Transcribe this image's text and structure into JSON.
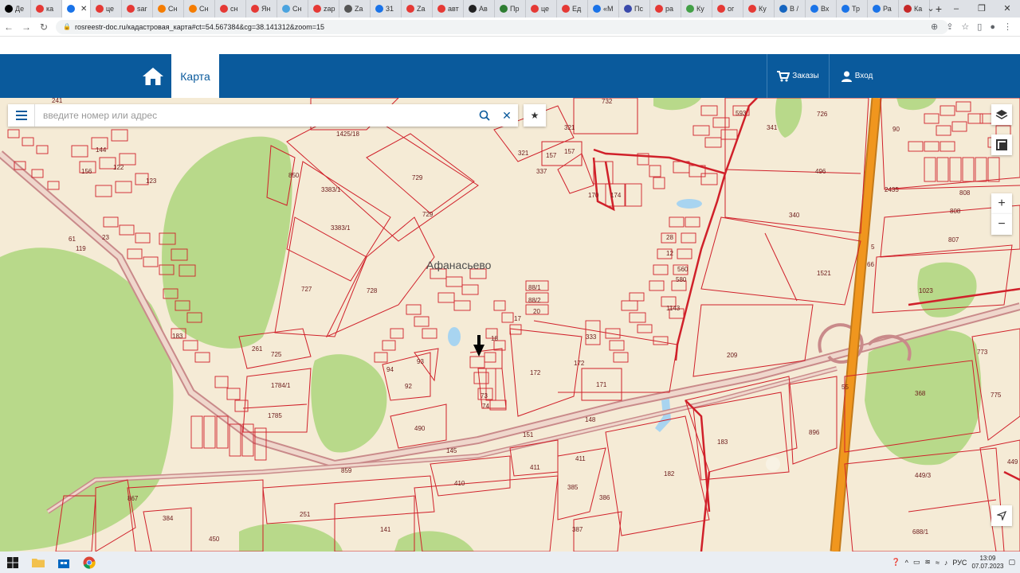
{
  "browser": {
    "tabs": [
      {
        "label": "Де",
        "color": "#000000"
      },
      {
        "label": "ка",
        "color": "#e53935"
      },
      {
        "label": "",
        "color": "#1a73e8",
        "active": true
      },
      {
        "label": "це",
        "color": "#e53935"
      },
      {
        "label": "sar",
        "color": "#e53935"
      },
      {
        "label": "Сн",
        "color": "#f57c00"
      },
      {
        "label": "Сн",
        "color": "#f57c00"
      },
      {
        "label": "сн",
        "color": "#e53935"
      },
      {
        "label": "Ян",
        "color": "#e53935"
      },
      {
        "label": "Сн",
        "color": "#4aa3df"
      },
      {
        "label": "zap",
        "color": "#e53935"
      },
      {
        "label": "Za",
        "color": "#555555"
      },
      {
        "label": "31",
        "color": "#1a73e8"
      },
      {
        "label": "Za",
        "color": "#e53935"
      },
      {
        "label": "авт",
        "color": "#e53935"
      },
      {
        "label": "Ав",
        "color": "#222222"
      },
      {
        "label": "Пр",
        "color": "#2e7d32"
      },
      {
        "label": "це",
        "color": "#e53935"
      },
      {
        "label": "Ед",
        "color": "#e53935"
      },
      {
        "label": "«М",
        "color": "#1a73e8"
      },
      {
        "label": "Пс",
        "color": "#3949ab"
      },
      {
        "label": "ра",
        "color": "#e53935"
      },
      {
        "label": "Ку",
        "color": "#43a047"
      },
      {
        "label": "ог",
        "color": "#e53935"
      },
      {
        "label": "Ку",
        "color": "#e53935"
      },
      {
        "label": "В /",
        "color": "#1565c0"
      },
      {
        "label": "Вх",
        "color": "#1a73e8"
      },
      {
        "label": "Тр",
        "color": "#1a73e8"
      },
      {
        "label": "Ра",
        "color": "#1a73e8"
      },
      {
        "label": "Ка",
        "color": "#c62828"
      }
    ],
    "active_tab_close": "✕",
    "new_tab": "+",
    "url": "rosreestr-doc.ru/кадастровая_карта#ct=54.567384&cg=38.141312&zoom=15"
  },
  "site": {
    "map_tab_label": "Карта",
    "orders_label": "Заказы",
    "login_label": "Вход"
  },
  "search": {
    "placeholder": "введите номер или адрес"
  },
  "map": {
    "village_label": "Афанасьево",
    "parcel_labels": [
      {
        "text": "732"
      },
      {
        "text": "593"
      },
      {
        "text": "726"
      },
      {
        "text": "90"
      },
      {
        "text": "321"
      },
      {
        "text": "321"
      },
      {
        "text": "157"
      },
      {
        "text": "157"
      },
      {
        "text": "337"
      },
      {
        "text": "341"
      },
      {
        "text": "1425/18"
      },
      {
        "text": "850"
      },
      {
        "text": "729"
      },
      {
        "text": "729"
      },
      {
        "text": "3383/1"
      },
      {
        "text": "3383/1"
      },
      {
        "text": "496"
      },
      {
        "text": "2435"
      },
      {
        "text": "808"
      },
      {
        "text": "808"
      },
      {
        "text": "340"
      },
      {
        "text": "807"
      },
      {
        "text": "1521"
      },
      {
        "text": "1023"
      },
      {
        "text": "727"
      },
      {
        "text": "728"
      },
      {
        "text": "88/1"
      },
      {
        "text": "88/2"
      },
      {
        "text": "20"
      },
      {
        "text": "17"
      },
      {
        "text": "18"
      },
      {
        "text": "333"
      },
      {
        "text": "28"
      },
      {
        "text": "12"
      },
      {
        "text": "560"
      },
      {
        "text": "580"
      },
      {
        "text": "1143"
      },
      {
        "text": "170"
      },
      {
        "text": "174"
      },
      {
        "text": "261"
      },
      {
        "text": "725"
      },
      {
        "text": "94"
      },
      {
        "text": "93"
      },
      {
        "text": "92"
      },
      {
        "text": "172"
      },
      {
        "text": "172"
      },
      {
        "text": "171"
      },
      {
        "text": "209"
      },
      {
        "text": "773"
      },
      {
        "text": "1784/1"
      },
      {
        "text": "73"
      },
      {
        "text": "74"
      },
      {
        "text": "55"
      },
      {
        "text": "368"
      },
      {
        "text": "775"
      },
      {
        "text": "1785"
      },
      {
        "text": "148"
      },
      {
        "text": "490"
      },
      {
        "text": "151"
      },
      {
        "text": "145"
      },
      {
        "text": "183"
      },
      {
        "text": "896"
      },
      {
        "text": "411"
      },
      {
        "text": "411"
      },
      {
        "text": "859"
      },
      {
        "text": "449"
      },
      {
        "text": "449/3"
      },
      {
        "text": "410"
      },
      {
        "text": "385"
      },
      {
        "text": "182"
      },
      {
        "text": "386"
      },
      {
        "text": "867"
      },
      {
        "text": "251"
      },
      {
        "text": "384"
      },
      {
        "text": "141"
      },
      {
        "text": "387"
      },
      {
        "text": "688/1"
      },
      {
        "text": "450"
      },
      {
        "text": "144"
      },
      {
        "text": "122"
      },
      {
        "text": "156"
      },
      {
        "text": "123"
      },
      {
        "text": "23"
      },
      {
        "text": "119"
      },
      {
        "text": "61"
      },
      {
        "text": "183"
      },
      {
        "text": "241"
      },
      {
        "text": "66"
      },
      {
        "text": "5"
      }
    ]
  },
  "taskbar": {
    "language": "РУС",
    "time": "13:09",
    "date": "07.07.2023"
  },
  "colors": {
    "header_blue": "#0a5a9c",
    "parcel_red": "#d0202a",
    "map_bg": "#f5ebd6",
    "forest_green": "#b8d98a",
    "highway_orange": "#f0961e"
  }
}
